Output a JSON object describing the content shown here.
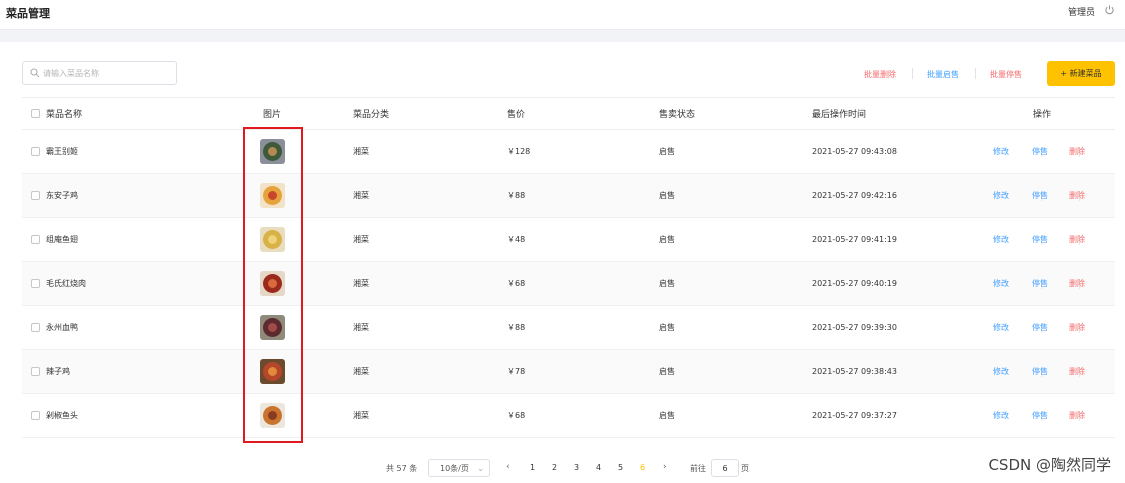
{
  "header": {
    "title": "菜品管理",
    "admin": "管理员"
  },
  "toolbar": {
    "search_placeholder": "请输入菜品名称",
    "batch_delete": "批量删除",
    "batch_enable": "批量启售",
    "batch_disable": "批量停售",
    "new_dish": "+ 新建菜品"
  },
  "table": {
    "columns": [
      "菜品名称",
      "图片",
      "菜品分类",
      "售价",
      "售卖状态",
      "最后操作时间",
      "操作"
    ],
    "rows": [
      {
        "name": "霸王别姬",
        "category": "湘菜",
        "price": "￥128",
        "status": "启售",
        "time": "2021-05-27 09:43:08"
      },
      {
        "name": "东安子鸡",
        "category": "湘菜",
        "price": "￥88",
        "status": "启售",
        "time": "2021-05-27 09:42:16"
      },
      {
        "name": "组庵鱼翅",
        "category": "湘菜",
        "price": "￥48",
        "status": "启售",
        "time": "2021-05-27 09:41:19"
      },
      {
        "name": "毛氏红烧肉",
        "category": "湘菜",
        "price": "￥68",
        "status": "启售",
        "time": "2021-05-27 09:40:19"
      },
      {
        "name": "永州血鸭",
        "category": "湘菜",
        "price": "￥88",
        "status": "启售",
        "time": "2021-05-27 09:39:30"
      },
      {
        "name": "辣子鸡",
        "category": "湘菜",
        "price": "￥78",
        "status": "启售",
        "time": "2021-05-27 09:38:43"
      },
      {
        "name": "剁椒鱼头",
        "category": "湘菜",
        "price": "￥68",
        "status": "启售",
        "time": "2021-05-27 09:37:27"
      }
    ],
    "ops": {
      "edit": "修改",
      "stop": "停售",
      "delete": "删除"
    }
  },
  "pagination": {
    "total": "共 57 条",
    "page_size": "10条/页",
    "prev": "‹",
    "next": "›",
    "pages": [
      "1",
      "2",
      "3",
      "4",
      "5",
      "6"
    ],
    "current": "6",
    "goto_label": "前往",
    "goto_value": "6",
    "page_suffix": "页"
  },
  "watermark": "CSDN @陶然同学",
  "colors": {
    "accent": "#ffc200",
    "link": "#409eff",
    "danger": "#f56c6c",
    "highlight": "#e0191f"
  }
}
